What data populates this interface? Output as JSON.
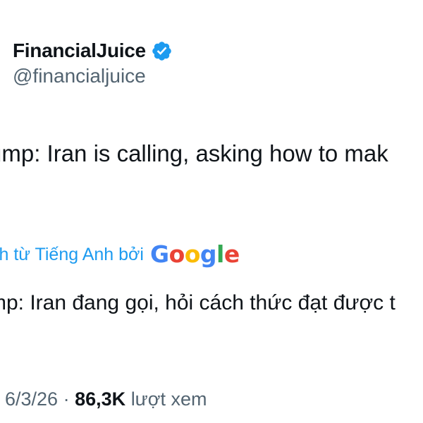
{
  "author": {
    "display_name": "FinancialJuice",
    "handle": "@financialjuice",
    "verified": true
  },
  "tweet": {
    "text": "ump: Iran is calling, asking how to mak"
  },
  "translation": {
    "label": "ch từ Tiếng Anh bởi",
    "provider": "Google",
    "text": "mp: Iran đang gọi, hỏi cách thức đạt được t"
  },
  "meta": {
    "date": "6/3/26",
    "separator": "·",
    "views_count": "86,3K",
    "views_label": "lượt xem"
  },
  "colors": {
    "verified_badge": "#1d9bf0",
    "link": "#1d9bf0",
    "secondary_text": "#536471",
    "primary_text": "#0f1419"
  }
}
